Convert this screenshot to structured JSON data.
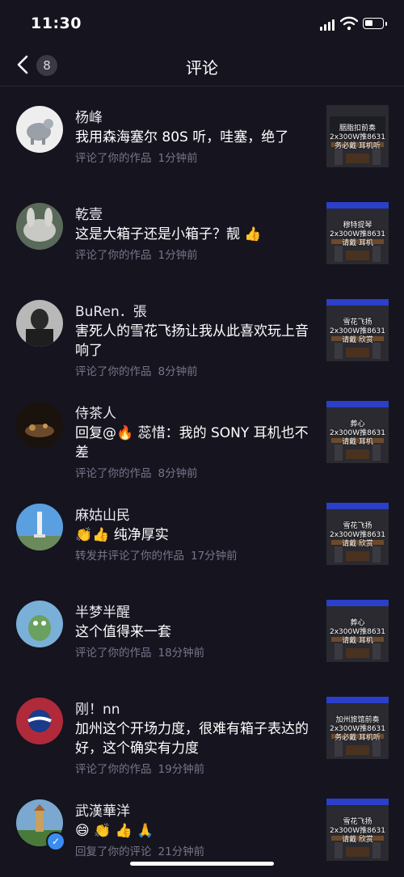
{
  "status": {
    "time": "11:30"
  },
  "nav": {
    "back_count": "8",
    "title": "评论"
  },
  "comments": [
    {
      "name": "杨峰",
      "text": "我用森海塞尔 80S 听，哇塞，绝了",
      "action": "评论了你的作品",
      "time": "1分钟前",
      "thumb": [
        "胭脂扣前奏",
        "2x300W推8631",
        "务必戴  耳机听"
      ]
    },
    {
      "name": "乾壹",
      "text": "这是大箱子还是小箱子？靓 👍",
      "action": "评论了你的作品",
      "time": "1分钟前",
      "thumb": [
        "穆特提琴",
        "2x300W推8631",
        "请戴   耳机"
      ]
    },
    {
      "name": "BuRen．張",
      "text": "害死人的雪花飞扬让我从此喜欢玩上音响了",
      "action": "评论了你的作品",
      "time": "8分钟前",
      "thumb": [
        "雪花飞扬",
        "2x300W推8631",
        "请戴   欣赏"
      ]
    },
    {
      "name": "侍茶人",
      "text": "回复@🔥  蕊惜：我的 SONY 耳机也不差",
      "action": "评论了你的作品",
      "time": "8分钟前",
      "thumb": [
        "葬心",
        "2x300W推8631",
        "请戴   耳机"
      ]
    },
    {
      "name": "麻姑山民",
      "text": "👏👍 纯净厚实",
      "action": "转发并评论了你的作品",
      "time": "17分钟前",
      "thumb": [
        "雪花飞扬",
        "2x300W推8631",
        "请戴   欣赏"
      ]
    },
    {
      "name": "半梦半醒",
      "text": "这个值得来一套",
      "action": "评论了你的作品",
      "time": "18分钟前",
      "thumb": [
        "葬心",
        "2x300W推8631",
        "请戴   耳机"
      ]
    },
    {
      "name": "刚！nn",
      "text": "加州这个开场力度，很难有箱子表达的好，这个确实有力度",
      "action": "评论了你的作品",
      "time": "19分钟前",
      "thumb": [
        "加州旅馆前奏",
        "2x300W推8631",
        "务必戴  耳机听"
      ]
    },
    {
      "name": "武漢華洋",
      "text": "😄 👏 👍 🙏",
      "action": "回复了你的评论",
      "time": "21分钟前",
      "thumb": [
        "雪花飞扬",
        "2x300W推8631",
        "请戴   欣赏"
      ]
    }
  ],
  "colors": {
    "bg": "#15141f",
    "meta": "#77768a",
    "verify": "#3b8cf0"
  }
}
